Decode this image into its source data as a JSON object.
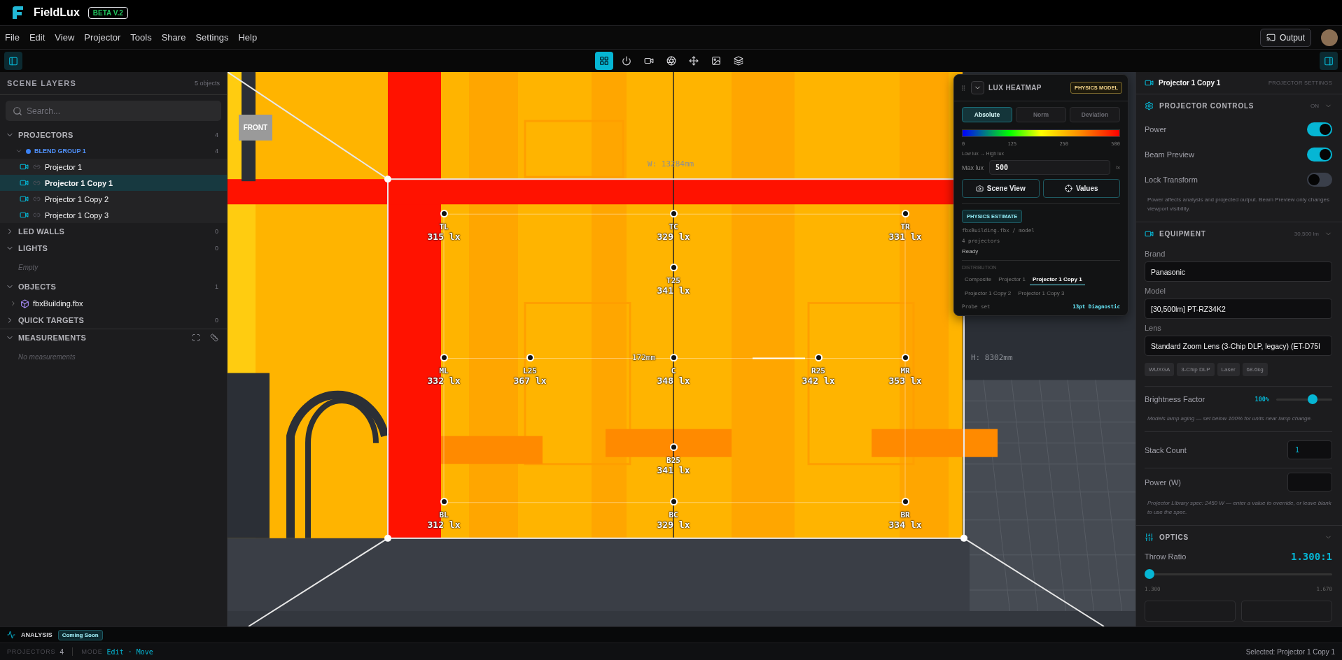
{
  "app": {
    "name": "FieldLux",
    "badge": "BETA V.2"
  },
  "menu": [
    "File",
    "Edit",
    "View",
    "Projector",
    "Tools",
    "Share",
    "Settings",
    "Help"
  ],
  "output_button": "Output",
  "toolbar": [
    {
      "kind": "grid",
      "selected": true
    },
    {
      "kind": "power",
      "selected": false
    },
    {
      "kind": "camera",
      "selected": false
    },
    {
      "kind": "aperture",
      "selected": false
    },
    {
      "kind": "move",
      "selected": false
    },
    {
      "kind": "image",
      "selected": false
    },
    {
      "kind": "layers",
      "selected": false
    }
  ],
  "scene_layers": {
    "title": "SCENE LAYERS",
    "count": "5 objects",
    "search": {
      "placeholder": "Search..."
    },
    "sections": [
      {
        "label": "PROJECTORS",
        "count": "4",
        "expanded": true,
        "groups": [
          {
            "label": "BLEND GROUP 1",
            "count": "4",
            "color": "#3b82f6",
            "expanded": true,
            "items": [
              {
                "kind": "projector",
                "label": "Projector 1",
                "selected": false
              },
              {
                "kind": "projector",
                "label": "Projector 1 Copy 1",
                "selected": true
              },
              {
                "kind": "projector",
                "label": "Projector 1 Copy 2",
                "selected": false
              },
              {
                "kind": "projector",
                "label": "Projector 1 Copy 3",
                "selected": false
              }
            ]
          }
        ]
      },
      {
        "label": "LED WALLS",
        "count": "0",
        "expanded": false
      },
      {
        "label": "LIGHTS",
        "count": "0",
        "expanded": true,
        "empty": "Empty"
      },
      {
        "label": "OBJECTS",
        "count": "1",
        "expanded": true,
        "items": [
          {
            "kind": "object",
            "label": "fbxBuilding.fbx",
            "selected": false
          }
        ]
      },
      {
        "label": "QUICK TARGETS",
        "count": "0",
        "expanded": false
      },
      {
        "label": "MEASUREMENTS",
        "expanded": true,
        "empty": "No measurements"
      }
    ]
  },
  "viewport": {
    "front_label": "FRONT",
    "width_label": "W: 13284mm",
    "height_label": "H: 8302mm",
    "center_label": "172mm",
    "probes": [
      {
        "label": "TL",
        "reading": "315 lx"
      },
      {
        "label": "TC",
        "reading": "329 lx"
      },
      {
        "label": "TR",
        "reading": "331 lx"
      },
      {
        "label": "T25",
        "reading": "341 lx"
      },
      {
        "label": "ML",
        "reading": "332 lx"
      },
      {
        "label": "L25",
        "reading": "367 lx"
      },
      {
        "label": "C",
        "reading": "348 lx"
      },
      {
        "label": "R25",
        "reading": "342 lx"
      },
      {
        "label": "MR",
        "reading": "353 lx"
      },
      {
        "label": "B25",
        "reading": "341 lx"
      },
      {
        "label": "BL",
        "reading": "312 lx"
      },
      {
        "label": "BC",
        "reading": "329 lx"
      },
      {
        "label": "BR",
        "reading": "334 lx"
      }
    ]
  },
  "heatmap": {
    "title": "LUX HEATMAP",
    "badge": "PHYSICS MODEL",
    "modes": [
      {
        "label": "Absolute",
        "selected": true
      },
      {
        "label": "Norm",
        "selected": false
      },
      {
        "label": "Deviation",
        "selected": false
      }
    ],
    "ticks": [
      "0",
      "125",
      "250",
      "500"
    ],
    "legend": "Low lux → High lux",
    "max_label": "Max lux",
    "max_value": "500",
    "unit": "lx",
    "buttons": [
      {
        "kind": "camera",
        "label": "Scene View"
      },
      {
        "kind": "target",
        "label": "Values"
      }
    ],
    "estimate_badge": "PHYSICS ESTIMATE",
    "source": "fbxBuilding.fbx / model",
    "projectors": "4 projectors",
    "status": "Ready",
    "distribution_label": "DISTRIBUTION",
    "distribution": [
      {
        "label": "Composite",
        "selected": false
      },
      {
        "label": "Projector 1",
        "selected": false
      },
      {
        "label": "Projector 1 Copy 1",
        "selected": true
      },
      {
        "label": "Projector 1 Copy 2",
        "selected": false
      },
      {
        "label": "Projector 1 Copy 3",
        "selected": false
      }
    ],
    "probe_set_label": "Probe set",
    "probe_set": "13pt Diagnostic"
  },
  "inspector": {
    "title": "Projector 1 Copy 1",
    "subtitle": "PROJECTOR SETTINGS",
    "controls": {
      "title": "PROJECTOR CONTROLS",
      "status": "ON",
      "toggles": [
        {
          "label": "Power",
          "on": true
        },
        {
          "label": "Beam Preview",
          "on": true
        },
        {
          "label": "Lock Transform",
          "on": false
        }
      ],
      "note": "Power affects analysis and projected output. Beam Preview only changes viewport visibility."
    },
    "equipment": {
      "title": "EQUIPMENT",
      "summary": "30,500 lm",
      "fields": [
        {
          "label": "Brand",
          "value": "Panasonic"
        },
        {
          "label": "Model",
          "value": "[30,500lm] PT-RZ34K2"
        },
        {
          "label": "Lens",
          "value": "Standard Zoom Lens (3-Chip DLP, legacy) (ET-D75I"
        }
      ],
      "tags": [
        "WUXGA",
        "3-Chip DLP",
        "Laser",
        "68.6kg"
      ],
      "brightness": {
        "label": "Brightness Factor",
        "reading": "100%",
        "level": 0.68
      },
      "brightness_note": "Models lamp aging — set below 100% for units near lamp change.",
      "stack": {
        "label": "Stack Count",
        "value": "1"
      },
      "power": {
        "label": "Power (W)"
      },
      "power_note": "Projector Library spec: 2450 W — enter a value to override, or leave blank to use the spec."
    },
    "optics": {
      "title": "OPTICS",
      "throw": {
        "label": "Throw Ratio",
        "reading": "1.300:1",
        "level": 0,
        "min": "1.300",
        "max": "1.670"
      }
    }
  },
  "analysis": {
    "title": "ANALYSIS",
    "badge": "Coming Soon"
  },
  "status_bar": {
    "projectors_label": "PROJECTORS",
    "projectors": "4",
    "mode_label": "MODE",
    "mode": "Edit",
    "separator": "·",
    "tool": "Move",
    "selected": "Selected: Projector 1 Copy 1"
  }
}
